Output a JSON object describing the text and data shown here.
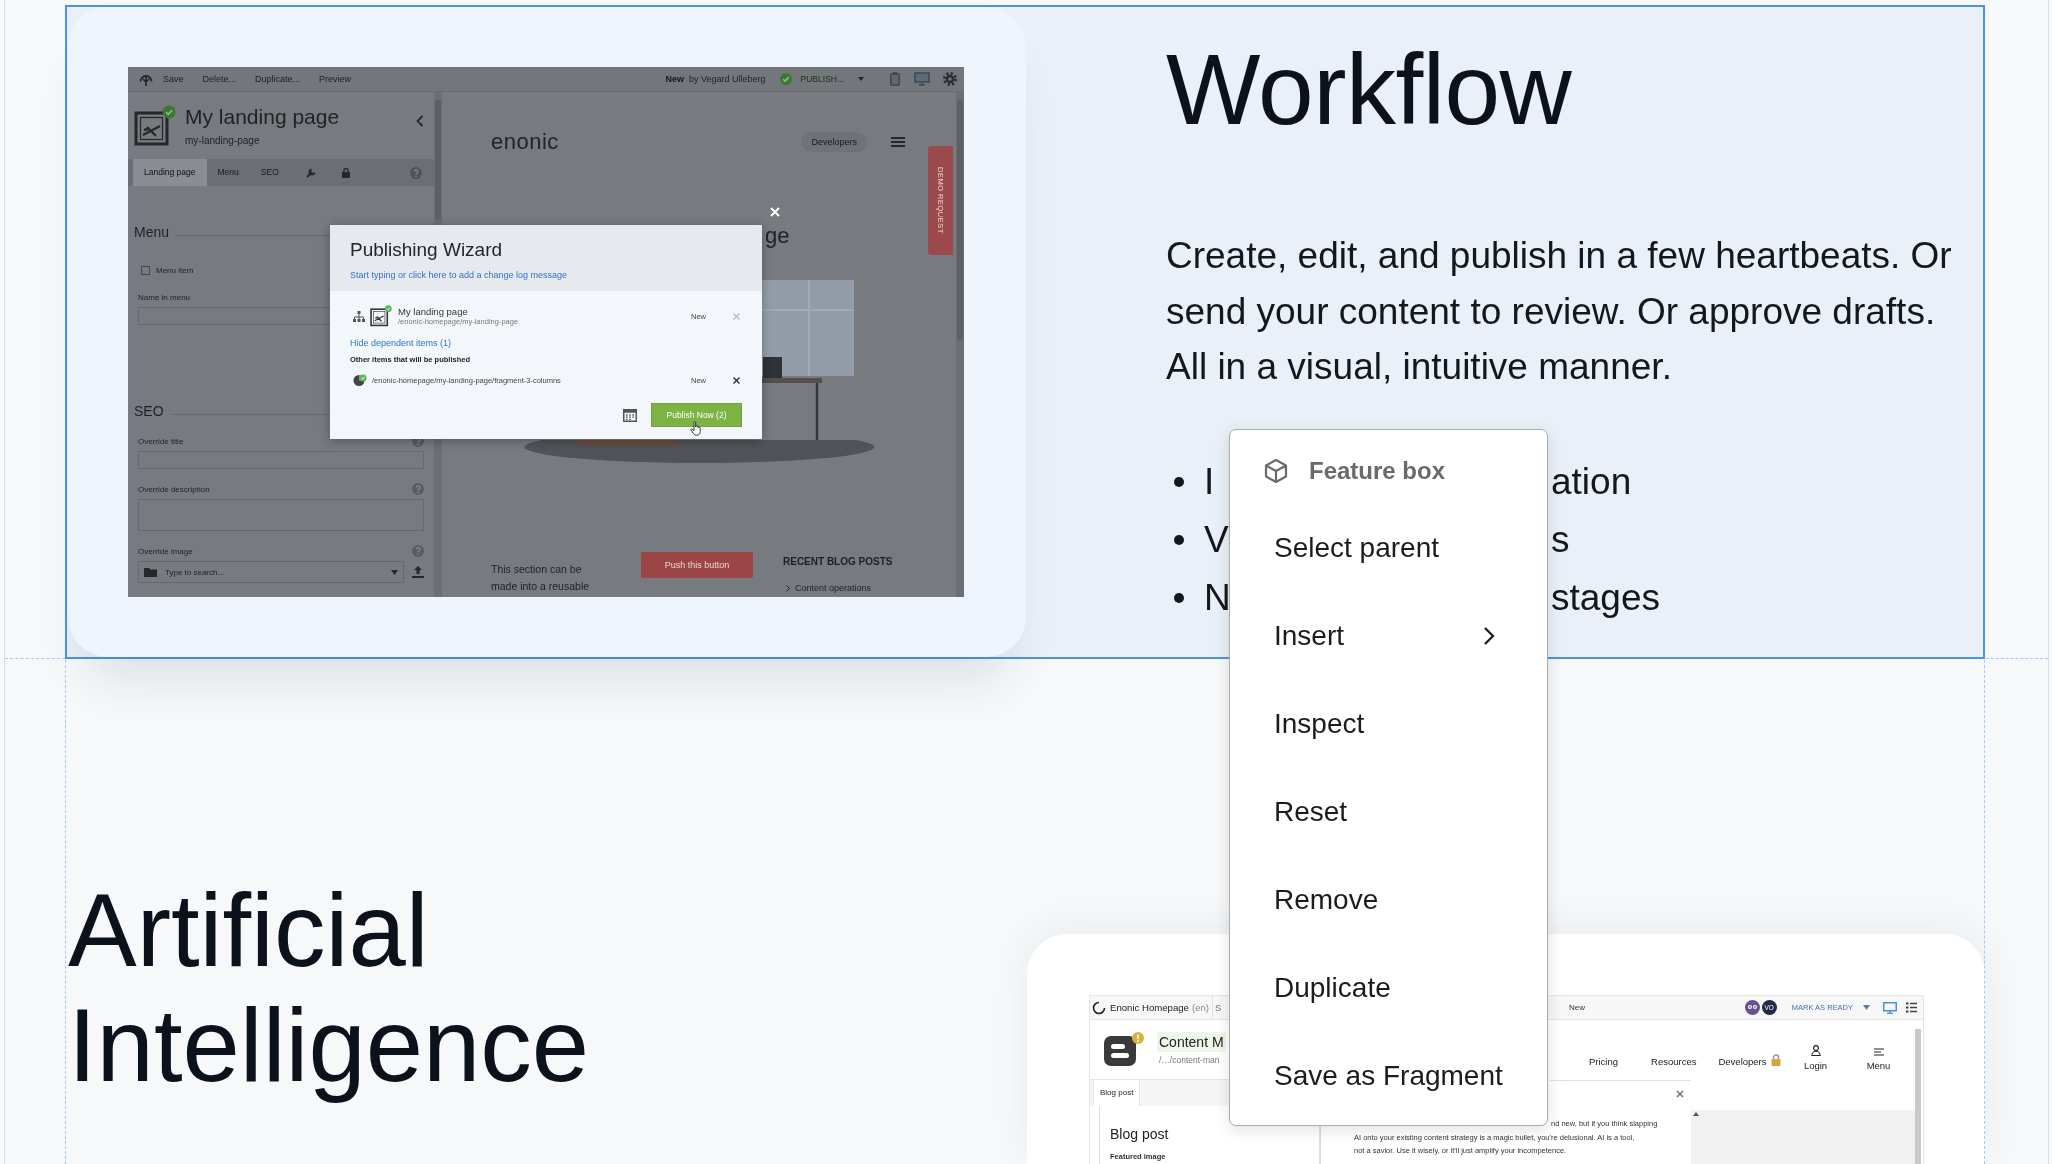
{
  "workflow_section": {
    "selected": true,
    "editor_screenshot": {
      "toolbar": {
        "actions": [
          "Save",
          "Delete...",
          "Duplicate...",
          "Preview"
        ],
        "status": "New",
        "modified_by": "by Vegard Ulleberg",
        "publish_menu": "PUBLISH..."
      },
      "content": {
        "title": "My landing page",
        "path": "my-landing-page"
      },
      "tabs": [
        {
          "label": "Landing page",
          "selected": true
        },
        {
          "label": "Menu",
          "selected": false
        },
        {
          "label": "SEO",
          "selected": false
        }
      ],
      "form": [
        {
          "kind": "heading",
          "label": "Menu"
        },
        {
          "kind": "checkbox",
          "label": "Menu item",
          "checked": false
        },
        {
          "kind": "input",
          "label": "Name in menu"
        },
        {
          "kind": "heading",
          "label": "SEO"
        },
        {
          "kind": "input",
          "label": "Override title",
          "help": true
        },
        {
          "kind": "textarea",
          "label": "Override description",
          "help": true
        },
        {
          "kind": "combobox",
          "label": "Override image",
          "placeholder": "Type to search...",
          "help": true
        }
      ],
      "preview": {
        "logo": "enonic",
        "nav_button": "Developers",
        "side_tab": "DEMO REQUEST",
        "heading_fragment": "ge",
        "section_text": "This section can be made into a reusable",
        "cta_button": "Push this button",
        "sidebar_heading": "RECENT BLOG POSTS",
        "sidebar_link": "Content operations"
      },
      "dialog": {
        "title": "Publishing Wizard",
        "change_log_link": "Start typing or click here to add a change log message",
        "items": [
          {
            "name": "My landing page",
            "path": "/enonic-homepage/my-landing-page",
            "status": "New",
            "removable": false
          }
        ],
        "dependents_toggle": "Hide dependent items (1)",
        "dependents_heading": "Other items that will be published",
        "dependents": [
          {
            "path": "/enonic-homepage/my-landing-page/fragment-3-columns",
            "status": "New",
            "removable": true
          }
        ],
        "publish_button": "Publish Now (2)"
      }
    },
    "heading": "Workflow",
    "description": "Create, edit, and publish in a few heartbeats. Or send your content to review. Or approve drafts. All in a visual, intuitive manner.",
    "bullets": [
      {
        "visible_start": "I",
        "visible_end": "ation"
      },
      {
        "visible_start": "V",
        "visible_end": "s"
      },
      {
        "visible_start": "N",
        "visible_end": "stages"
      }
    ]
  },
  "ai_section": {
    "heading": "Artificial Intelligence",
    "app_screenshot": {
      "topbar": {
        "project": "Enonic Homepage",
        "language": "(en)",
        "cut_label": "S",
        "status": "New",
        "avatar_initials": "VO",
        "workflow_action": "MARK AS READY"
      },
      "content": {
        "name": "Content M",
        "path": "/…/content-man",
        "has_warning": true
      },
      "tabs": [
        {
          "label": "Blog post",
          "selected": true
        }
      ],
      "site_nav": [
        "Pricing",
        "Resources",
        "Developers"
      ],
      "login": "Login",
      "menu": "Menu",
      "form": {
        "heading": "Blog post",
        "field_label": "Featured image"
      },
      "body_lines": [
        "nd new, but if you think slapping",
        "AI onto your existing content strategy is a magic bullet, you're delusional. AI is a tool,",
        "not a savior. Use it wisely, or it'll just amplify your incompetence."
      ]
    }
  },
  "context_menu": {
    "title": "Feature box",
    "items": [
      {
        "label": "Select parent",
        "submenu": false
      },
      {
        "label": "Insert",
        "submenu": true
      },
      {
        "label": "Inspect",
        "submenu": false
      },
      {
        "label": "Reset",
        "submenu": false
      },
      {
        "label": "Remove",
        "submenu": false
      },
      {
        "label": "Duplicate",
        "submenu": false
      },
      {
        "label": "Save as Fragment",
        "submenu": false
      }
    ]
  }
}
